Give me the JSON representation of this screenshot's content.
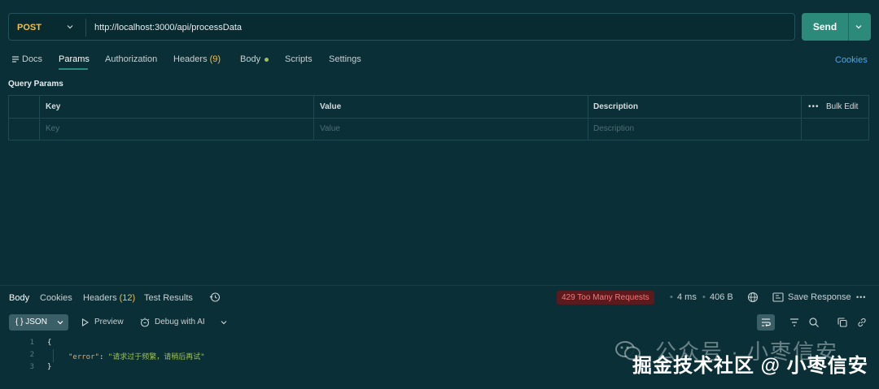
{
  "request": {
    "method": "POST",
    "url": "http://localhost:3000/api/processData",
    "send_label": "Send"
  },
  "request_tabs": {
    "docs": "Docs",
    "params": "Params",
    "authorization": "Authorization",
    "headers": "Headers",
    "headers_count": "(9)",
    "body": "Body",
    "scripts": "Scripts",
    "settings": "Settings",
    "cookies": "Cookies"
  },
  "query_params": {
    "title": "Query Params",
    "columns": [
      "Key",
      "Value",
      "Description"
    ],
    "placeholders": [
      "Key",
      "Value",
      "Description"
    ],
    "bulk_edit": "Bulk Edit",
    "more": "•••"
  },
  "response_tabs": {
    "body": "Body",
    "cookies": "Cookies",
    "headers": "Headers",
    "headers_count": "(12)",
    "test_results": "Test Results"
  },
  "response_meta": {
    "status": "429 Too Many Requests",
    "time": "4 ms",
    "size": "406 B",
    "save_response": "Save Response",
    "more": "•••"
  },
  "response_toolbar": {
    "format": "JSON",
    "format_icon": "{ }",
    "preview": "Preview",
    "debug": "Debug with AI"
  },
  "response_body": {
    "lines": [
      {
        "no": "1",
        "text": "{"
      },
      {
        "no": "2",
        "key": "\"error\"",
        "colon": ": ",
        "value": "\"请求过于频繁，请稍后再试\""
      },
      {
        "no": "3",
        "text": "}"
      }
    ]
  },
  "watermark": {
    "line1": "公众号 · 小枣信安",
    "line2": "掘金技术社区 @ 小枣信安"
  },
  "colors": {
    "background": "#0a2f36",
    "accent": "#2b8a7a",
    "method": "#f0c14b",
    "status_error_bg": "#5a1a1e",
    "status_error_text": "#f07a7a",
    "link": "#4ea6e8"
  }
}
